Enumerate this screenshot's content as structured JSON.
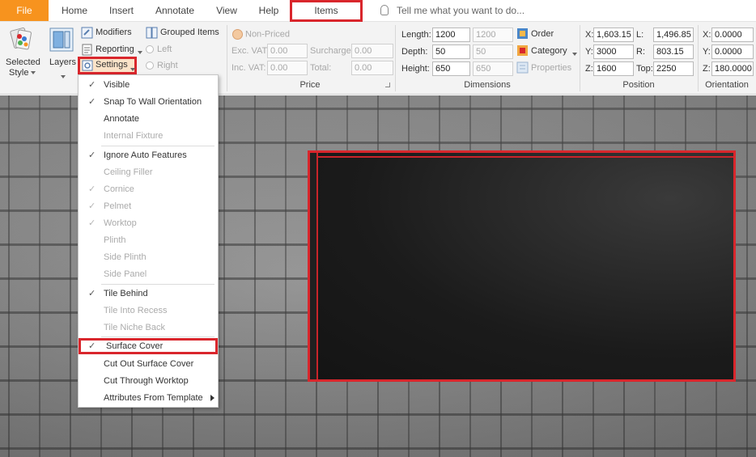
{
  "tabs": [
    {
      "label": "File"
    },
    {
      "label": "Home"
    },
    {
      "label": "Insert"
    },
    {
      "label": "Annotate"
    },
    {
      "label": "View"
    },
    {
      "label": "Help"
    },
    {
      "label": "Items"
    }
  ],
  "tell_me": "Tell me what you want to do...",
  "ribbon": {
    "selected_style_line1": "Selected",
    "selected_style_line2": "Style",
    "layers": "Layers",
    "modifiers": "Modifiers",
    "grouped_items": "Grouped Items",
    "reporting": "Reporting",
    "settings": "Settings",
    "left": "Left",
    "right": "Right",
    "price": {
      "non_priced": "Non-Priced",
      "exc_vat_label": "Exc. VAT:",
      "exc_vat": "0.00",
      "inc_vat_label": "Inc. VAT:",
      "inc_vat": "0.00",
      "surcharge_label": "Surcharge:",
      "surcharge": "0.00",
      "total_label": "Total:",
      "total": "0.00",
      "group": "Price"
    },
    "dimensions": {
      "length_label": "Length:",
      "length": "1200",
      "length_2": "1200",
      "depth_label": "Depth:",
      "depth": "50",
      "depth_2": "50",
      "height_label": "Height:",
      "height": "650",
      "height_2": "650",
      "order": "Order",
      "category": "Category",
      "properties": "Properties",
      "group": "Dimensions"
    },
    "position": {
      "x_label": "X:",
      "x": "1,603.15",
      "l_label": "L:",
      "l": "1,496.85",
      "y_label": "Y:",
      "y": "3000",
      "r_label": "R:",
      "r": "803.15",
      "z_label": "Z:",
      "z": "1600",
      "top_label": "Top:",
      "top": "2250",
      "group": "Position"
    },
    "orientation": {
      "x_label": "X:",
      "x": "0.0000",
      "y_label": "Y:",
      "y": "0.0000",
      "z_label": "Z:",
      "z": "180.0000",
      "group": "Orientation"
    }
  },
  "menu": [
    {
      "label": "Visible",
      "checked": true,
      "enabled": true
    },
    {
      "label": "Snap To Wall Orientation",
      "checked": true,
      "enabled": true
    },
    {
      "label": "Annotate",
      "checked": false,
      "enabled": true
    },
    {
      "label": "Internal Fixture",
      "checked": false,
      "enabled": false
    },
    {
      "label": "Ignore Auto Features",
      "checked": true,
      "enabled": true
    },
    {
      "label": "Ceiling Filler",
      "checked": false,
      "enabled": false
    },
    {
      "label": "Cornice",
      "checked": true,
      "enabled": false
    },
    {
      "label": "Pelmet",
      "checked": true,
      "enabled": false
    },
    {
      "label": "Worktop",
      "checked": true,
      "enabled": false
    },
    {
      "label": "Plinth",
      "checked": false,
      "enabled": false
    },
    {
      "label": "Side Plinth",
      "checked": false,
      "enabled": false
    },
    {
      "label": "Side Panel",
      "checked": false,
      "enabled": false
    },
    {
      "label": "Tile Behind",
      "checked": true,
      "enabled": true
    },
    {
      "label": "Tile Into Recess",
      "checked": false,
      "enabled": false
    },
    {
      "label": "Tile Niche Back",
      "checked": false,
      "enabled": false
    },
    {
      "label": "Surface Cover",
      "checked": true,
      "enabled": true
    },
    {
      "label": "Cut Out Surface Cover",
      "checked": false,
      "enabled": true
    },
    {
      "label": "Cut Through Worktop",
      "checked": false,
      "enabled": true
    },
    {
      "label": "Attributes From Template",
      "checked": false,
      "enabled": true
    }
  ],
  "checkmark": "✓",
  "colors": {
    "accent_orange": "#f7931e",
    "highlight_red": "#d9262c"
  }
}
